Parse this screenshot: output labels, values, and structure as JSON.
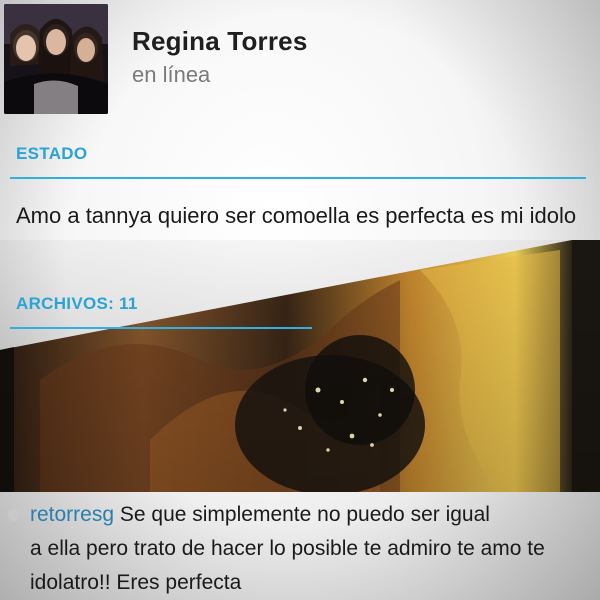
{
  "contact": {
    "name": "Regina Torres",
    "status": "en línea"
  },
  "estado": {
    "label": "ESTADO",
    "text": "Amo a tannya quiero ser comoella es perfecta es mi idolo"
  },
  "archivos": {
    "label": "ARCHIVOS: 11"
  },
  "comment": {
    "username": "retorresg",
    "text_first": "Se que simplemente no puedo ser igual",
    "text_rest": "a ella pero trato de hacer lo posible te admiro te amo te idolatro!! Eres perfecta"
  },
  "colors": {
    "accent": "#2aa3d6",
    "username": "#2a7fae"
  }
}
